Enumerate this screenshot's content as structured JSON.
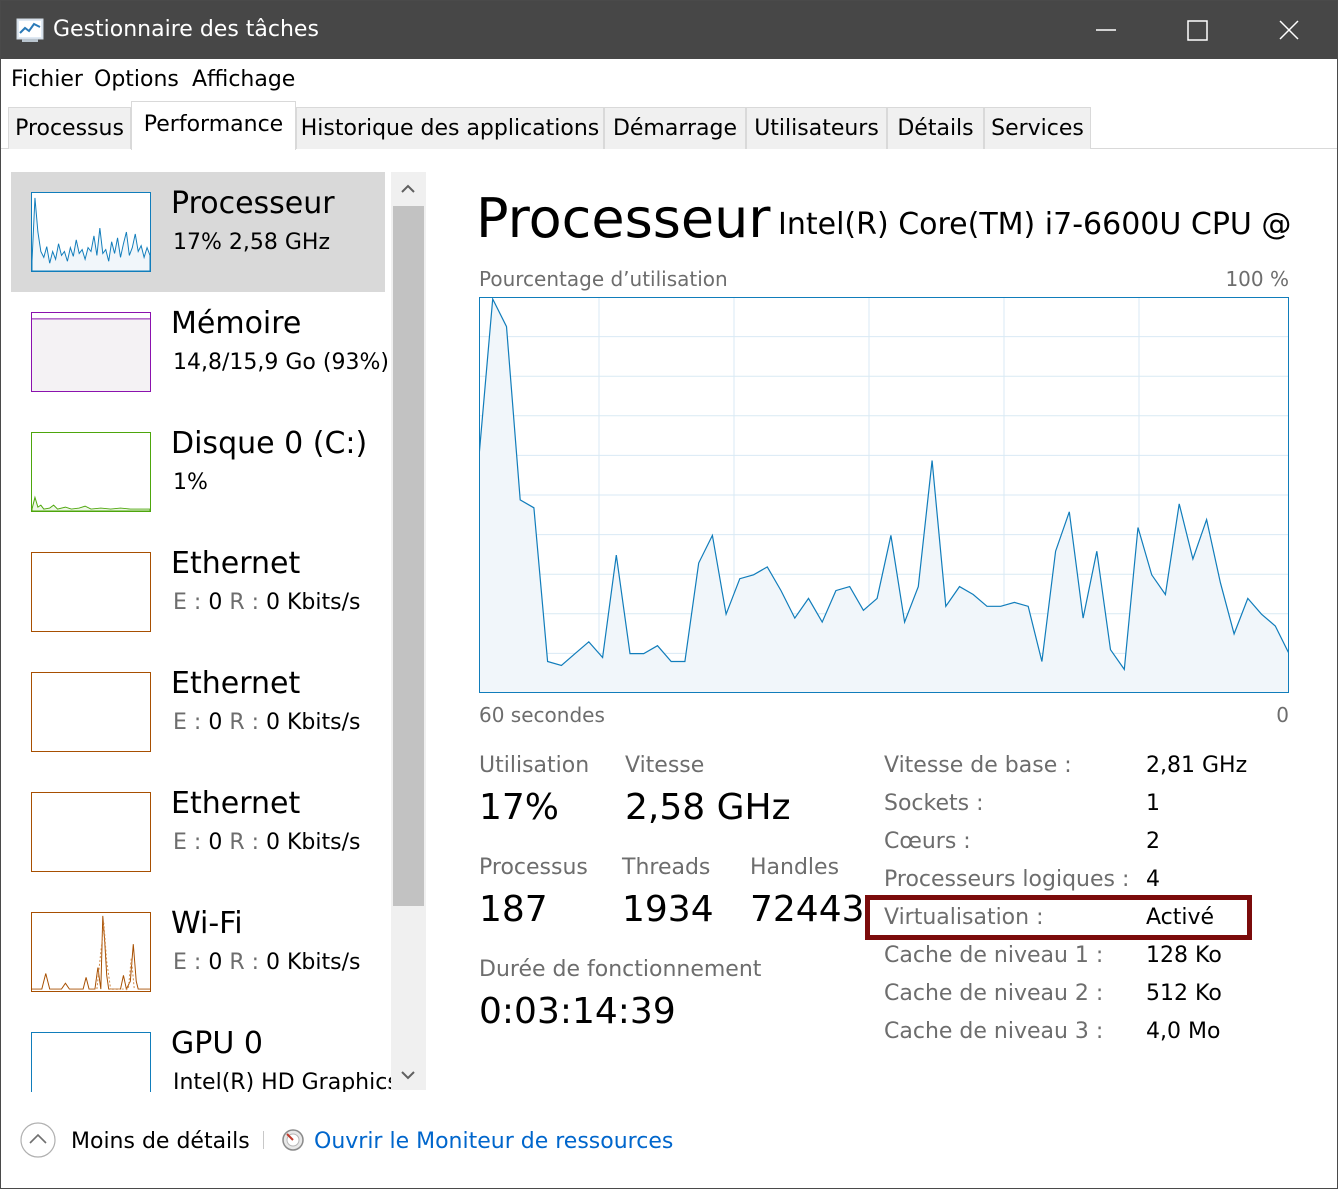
{
  "window": {
    "title": "Gestionnaire des tâches"
  },
  "menu": [
    "Fichier",
    "Options",
    "Affichage"
  ],
  "tabs": [
    {
      "label": "Processus",
      "active": false
    },
    {
      "label": "Performance",
      "active": true
    },
    {
      "label": "Historique des applications",
      "active": false
    },
    {
      "label": "Démarrage",
      "active": false
    },
    {
      "label": "Utilisateurs",
      "active": false
    },
    {
      "label": "Détails",
      "active": false
    },
    {
      "label": "Services",
      "active": false
    }
  ],
  "sidebar": {
    "items": [
      {
        "name": "Processeur",
        "sub": "17%  2,58 GHz",
        "color": "#117dbb",
        "selected": true
      },
      {
        "name": "Mémoire",
        "sub": "14,8/15,9 Go (93%)",
        "color": "#8b12ae"
      },
      {
        "name": "Disque 0 (C:)",
        "sub": "1%",
        "color": "#4da60c"
      },
      {
        "name": "Ethernet",
        "sub_e": "E :",
        "sub_e_val": "0",
        "sub_r": "R :",
        "sub_r_val": "0 Kbits/s",
        "color": "#a74f01"
      },
      {
        "name": "Ethernet",
        "sub_e": "E :",
        "sub_e_val": "0",
        "sub_r": "R :",
        "sub_r_val": "0 Kbits/s",
        "color": "#a74f01"
      },
      {
        "name": "Ethernet",
        "sub_e": "E :",
        "sub_e_val": "0",
        "sub_r": "R :",
        "sub_r_val": "0 Kbits/s",
        "color": "#a74f01"
      },
      {
        "name": "Wi-Fi",
        "sub_e": "E :",
        "sub_e_val": "0",
        "sub_r": "R :",
        "sub_r_val": "0 Kbits/s",
        "color": "#a74f01"
      },
      {
        "name": "GPU 0",
        "sub": "Intel(R) HD Graphics",
        "color": "#117dbb"
      }
    ]
  },
  "main": {
    "title": "Processeur",
    "subtitle": "Intel(R) Core(TM) i7-6600U CPU @...",
    "graph_label": "Pourcentage d’utilisation",
    "graph_max": "100 %",
    "axis_left": "60 secondes",
    "axis_right": "0",
    "stats": {
      "utilisation_label": "Utilisation",
      "utilisation": "17%",
      "vitesse_label": "Vitesse",
      "vitesse": "2,58 GHz",
      "processus_label": "Processus",
      "processus": "187",
      "threads_label": "Threads",
      "threads": "1934",
      "handles_label": "Handles",
      "handles": "72443",
      "uptime_label": "Durée de fonctionnement",
      "uptime": "0:03:14:39"
    },
    "info": [
      {
        "label": "Vitesse de base :",
        "value": "2,81 GHz"
      },
      {
        "label": "Sockets :",
        "value": "1"
      },
      {
        "label": "Cœurs :",
        "value": "2"
      },
      {
        "label": "Processeurs logiques :",
        "value": "4"
      },
      {
        "label": "Virtualisation :",
        "value": "Activé"
      },
      {
        "label": "Cache de niveau 1 :",
        "value": "128 Ko"
      },
      {
        "label": "Cache de niveau 2 :",
        "value": "512 Ko"
      },
      {
        "label": "Cache de niveau 3 :",
        "value": "4,0 Mo"
      }
    ],
    "highlight_color": "#7b0b0b"
  },
  "cpu_history_percent": [
    60,
    100,
    93,
    49,
    47,
    8,
    7,
    10,
    13,
    9,
    35,
    10,
    10,
    12,
    8,
    8,
    33,
    40,
    20,
    29,
    30,
    32,
    26,
    19,
    24,
    18,
    26,
    27,
    21,
    24,
    40,
    18,
    27,
    59,
    22,
    27,
    25,
    22,
    22,
    23,
    22,
    8,
    36,
    46,
    19,
    36,
    11,
    6,
    42,
    30,
    25,
    48,
    34,
    44,
    28,
    15,
    24,
    20,
    17,
    10
  ],
  "footer": {
    "fewer_details": "Moins de détails",
    "open_monitor": "Ouvrir le Moniteur de ressources"
  },
  "colors": {
    "accent": "#117dbb",
    "link": "#0066cc",
    "titlebar": "#474747"
  }
}
